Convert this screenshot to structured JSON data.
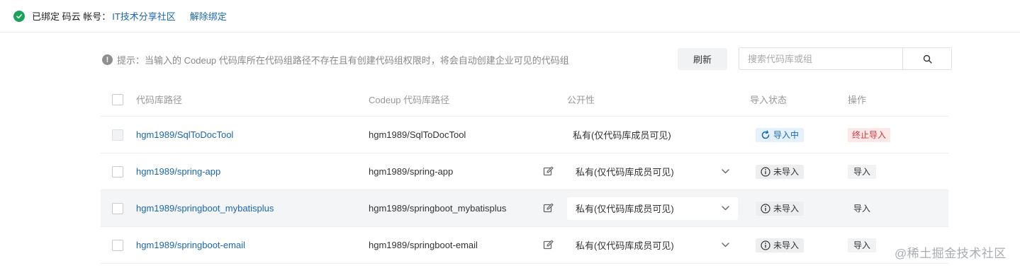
{
  "binding": {
    "status_text": "已绑定 码云 帐号：",
    "community": "IT技术分享社区",
    "unbind_label": "解除绑定"
  },
  "hint": {
    "icon_text": "!",
    "text": "提示：当输入的 Codeup 代码库所在代码组路径不存在且有创建代码组权限时，将会自动创建企业可见的代码组"
  },
  "toolbar": {
    "refresh_label": "刷新",
    "search_placeholder": "搜索代码库或组"
  },
  "table": {
    "columns": {
      "repo_path": "代码库路径",
      "codeup_path": "Codeup 代码库路径",
      "visibility": "公开性",
      "status": "导入状态",
      "action": "操作"
    },
    "rows": [
      {
        "repo": "hgm1989/SqlToDocTool",
        "codeup": "hgm1989/SqlToDocTool",
        "visibility": "私有(仅代码库成员可见)",
        "status": "导入中",
        "action": "终止导入"
      },
      {
        "repo": "hgm1989/spring-app",
        "codeup": "hgm1989/spring-app",
        "visibility": "私有(仅代码库成员可见)",
        "status": "未导入",
        "action": "导入"
      },
      {
        "repo": "hgm1989/springboot_mybatisplus",
        "codeup": "hgm1989/springboot_mybatisplus",
        "visibility": "私有(仅代码库成员可见)",
        "status": "未导入",
        "action": "导入"
      },
      {
        "repo": "hgm1989/springboot-email",
        "codeup": "hgm1989/springboot-email",
        "visibility": "私有(仅代码库成员可见)",
        "status": "未导入",
        "action": "导入"
      }
    ]
  },
  "watermark": "@稀土掘金技术社区",
  "colors": {
    "link": "#1b67b5",
    "success": "#1aa35a",
    "danger": "#d9363e",
    "importing_bg": "#e5f1fc",
    "row_highlight": "#f4f5f7"
  }
}
